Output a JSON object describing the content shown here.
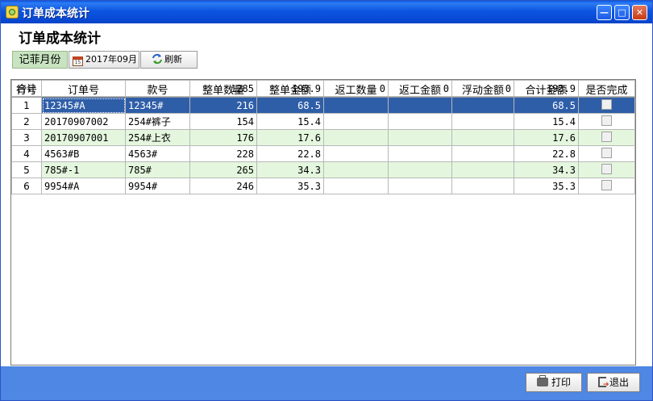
{
  "window": {
    "title": "订单成本统计"
  },
  "heading": "订单成本统计",
  "toolbar": {
    "month_label": "记菲月份",
    "month_value": "2017年09月",
    "refresh_label": "刷新"
  },
  "columns": [
    "行号",
    "订单号",
    "款号",
    "整单数量",
    "整单金额",
    "返工数量",
    "返工金额",
    "浮动金额",
    "合计金额",
    "是否完成"
  ],
  "rows": [
    {
      "no": "1",
      "order": "12345#A",
      "style": "12345#",
      "qty": "216",
      "amount": "68.5",
      "rework_qty": "",
      "rework_amt": "",
      "float_amt": "",
      "total": "68.5"
    },
    {
      "no": "2",
      "order": "20170907002",
      "style": "254#裤子",
      "qty": "154",
      "amount": "15.4",
      "rework_qty": "",
      "rework_amt": "",
      "float_amt": "",
      "total": "15.4"
    },
    {
      "no": "3",
      "order": "20170907001",
      "style": "254#上衣",
      "qty": "176",
      "amount": "17.6",
      "rework_qty": "",
      "rework_amt": "",
      "float_amt": "",
      "total": "17.6"
    },
    {
      "no": "4",
      "order": "4563#B",
      "style": "4563#",
      "qty": "228",
      "amount": "22.8",
      "rework_qty": "",
      "rework_amt": "",
      "float_amt": "",
      "total": "22.8"
    },
    {
      "no": "5",
      "order": "785#-1",
      "style": "785#",
      "qty": "265",
      "amount": "34.3",
      "rework_qty": "",
      "rework_amt": "",
      "float_amt": "",
      "total": "34.3"
    },
    {
      "no": "6",
      "order": "9954#A",
      "style": "9954#",
      "qty": "246",
      "amount": "35.3",
      "rework_qty": "",
      "rework_amt": "",
      "float_amt": "",
      "total": "35.3"
    }
  ],
  "totals": {
    "label": "合计",
    "qty": "1285",
    "amount": "193.9",
    "rework_qty": "0",
    "rework_amt": "0",
    "float_amt": "0",
    "total": "193.9"
  },
  "buttons": {
    "print": "打印",
    "exit": "退出"
  },
  "colors": {
    "titlebar": "#0a53e0",
    "selected_row": "#2f5ea8",
    "alt_row": "#e4f7de",
    "bottom_bar": "#4e87e4"
  }
}
